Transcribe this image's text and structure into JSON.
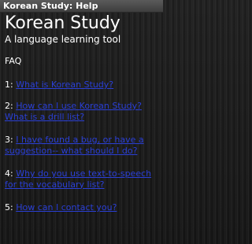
{
  "window": {
    "title": "Korean Study: Help"
  },
  "header": {
    "app_title": "Korean Study",
    "subtitle": "A language learning tool"
  },
  "faq": {
    "heading": "FAQ",
    "items": [
      {
        "number": "1:",
        "question": "What is Korean Study?"
      },
      {
        "number": "2:",
        "question": "How can I use Korean Study? What is a drill list?"
      },
      {
        "number": "3:",
        "question": "I have found a bug, or have a suggestion-- what should I do?"
      },
      {
        "number": "4:",
        "question": "Why do you use text-to-speech for the vocabulary list?"
      },
      {
        "number": "5:",
        "question": "How can I contact you?"
      }
    ]
  },
  "colors": {
    "link": "#2a3fd6",
    "text": "#ffffff",
    "background": "#1a1a1a",
    "title_bar": "#4a4a4a"
  }
}
